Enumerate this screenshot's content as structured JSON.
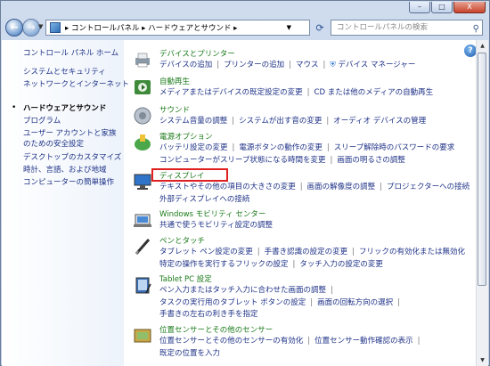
{
  "window": {
    "caption_buttons": [
      "–",
      "□",
      "X"
    ]
  },
  "nav": {
    "back_icon": "←",
    "forward_icon": "→",
    "address_path": "▸ コントロールパネル ▸ ハードウェアとサウンド ▸",
    "search_placeholder": "コントロールパネルの検索"
  },
  "sidebar": {
    "items": [
      {
        "label": "コントロール パネル ホーム"
      },
      {
        "label": "システムとセキュリティ"
      },
      {
        "label": "ネットワークとインターネット"
      },
      {
        "label": "ハードウェアとサウンド"
      },
      {
        "label": "プログラム"
      },
      {
        "label": "ユーザー アカウントと家族"
      },
      {
        "label": "のための安全設定"
      },
      {
        "label": "デスクトップのカスタマイズ"
      },
      {
        "label": "時計、言語、および地域"
      },
      {
        "label": "コンピューターの簡単操作"
      }
    ]
  },
  "categories": [
    {
      "title": "デバイスとプリンター",
      "icon": "printer-icon",
      "links": [
        "デバイスの追加",
        "プリンターの追加",
        "マウス",
        "デバイス マネージャー"
      ]
    },
    {
      "title": "自動再生",
      "icon": "autoplay-icon",
      "links": [
        "メディアまたはデバイスの既定設定の変更",
        "CD または他のメディアの自動再生"
      ]
    },
    {
      "title": "サウンド",
      "icon": "speaker-icon",
      "links": [
        "システム音量の調整",
        "システムが出す音の変更",
        "オーディオ デバイスの管理"
      ]
    },
    {
      "title": "電源オプション",
      "icon": "power-options-icon",
      "links": [
        "バッテリ設定の変更",
        "電源ボタンの動作の変更",
        "スリープ解除時のパスワードの要求",
        "コンピューターがスリープ状態になる時間を変更",
        "画面の明るさの調整"
      ]
    },
    {
      "title": "ディスプレイ",
      "icon": "display-icon",
      "links": [
        "テキストやその他の項目の大きさの変更",
        "画面の解像度の調整",
        "プロジェクターへの接続",
        "外部ディスプレイへの接続"
      ]
    },
    {
      "title": "Windows モビリティ センター",
      "icon": "mobility-center-icon",
      "links": [
        "共通で使うモビリティ設定の調整"
      ]
    },
    {
      "title": "ペンとタッチ",
      "icon": "pen-icon",
      "links": [
        "タブレット ペン設定の変更",
        "手書き認識の設定の変更",
        "フリックの有効化または無効化",
        "特定の操作を実行するフリックの設定",
        "タッチ入力の設定の変更"
      ]
    },
    {
      "title": "Tablet PC 設定",
      "icon": "tablet-icon",
      "links": [
        "ペン入力またはタッチ入力に合わせた画面の調整",
        "タスクの実行用のタブレット ボタンの設定",
        "画面の回転方向の選択",
        "手書きの左右の利き手を指定"
      ]
    },
    {
      "title": "位置センサーとその他のセンサー",
      "icon": "sensor-icon",
      "links": [
        "位置センサーとその他のセンサーの有効化",
        "位置センサー動作確認の表示",
        "既定の位置を入力"
      ]
    }
  ]
}
